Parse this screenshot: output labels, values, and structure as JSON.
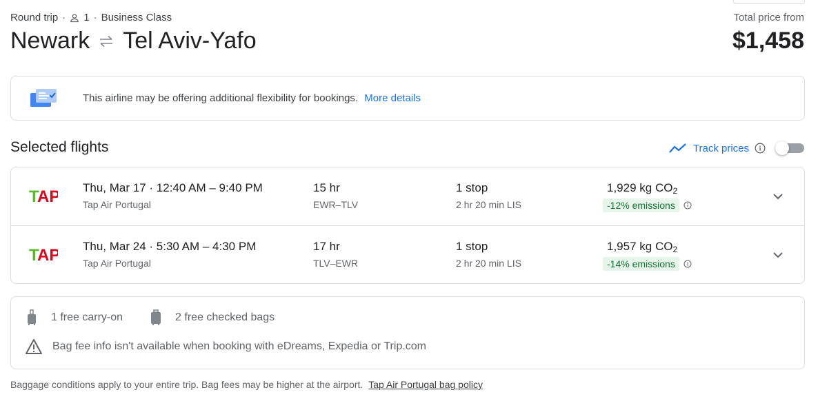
{
  "header": {
    "trip_type": "Round trip",
    "passengers": "1",
    "cabin_class": "Business Class",
    "origin": "Newark",
    "destination": "Tel Aviv-Yafo",
    "price_label": "Total price from",
    "price": "$1,458"
  },
  "flex_banner": {
    "text": "This airline may be offering additional flexibility for bookings.",
    "link": "More details"
  },
  "selected": {
    "title": "Selected flights",
    "track_label": "Track prices"
  },
  "flights": [
    {
      "date": "Thu, Mar 17",
      "time_range": "12:40 AM – 9:40 PM",
      "airline": "Tap Air Portugal",
      "duration": "15 hr",
      "airports": "EWR–TLV",
      "stops": "1 stop",
      "layover": "2 hr 20 min LIS",
      "co2_value": "1,929 kg CO",
      "emissions": "-12% emissions"
    },
    {
      "date": "Thu, Mar 24",
      "time_range": "5:30 AM – 4:30 PM",
      "airline": "Tap Air Portugal",
      "duration": "17 hr",
      "airports": "TLV–EWR",
      "stops": "1 stop",
      "layover": "2 hr 20 min LIS",
      "co2_value": "1,957 kg CO",
      "emissions": "-14% emissions"
    }
  ],
  "baggage": {
    "carry_on": "1 free carry-on",
    "checked": "2 free checked bags",
    "warning": "Bag fee info isn't available when booking with eDreams, Expedia or Trip.com"
  },
  "footnote": {
    "text": "Baggage conditions apply to your entire trip. Bag fees may be higher at the airport.",
    "link": "Tap Air Portugal bag policy"
  },
  "colors": {
    "link_blue": "#1a73e8",
    "emission_bg": "#e6f4ea",
    "emission_text": "#137333",
    "tap_green": "#5cb82d",
    "tap_red": "#e2001a"
  },
  "icons": {
    "swap": "swap-arrows-icon",
    "person": "person-icon",
    "banner": "booking-options-icon",
    "track": "trend-line-icon",
    "info": "info-icon",
    "expand": "chevron-down-icon",
    "carry_on": "carry-on-bag-icon",
    "checked": "checked-bag-icon",
    "warning": "warning-icon"
  }
}
